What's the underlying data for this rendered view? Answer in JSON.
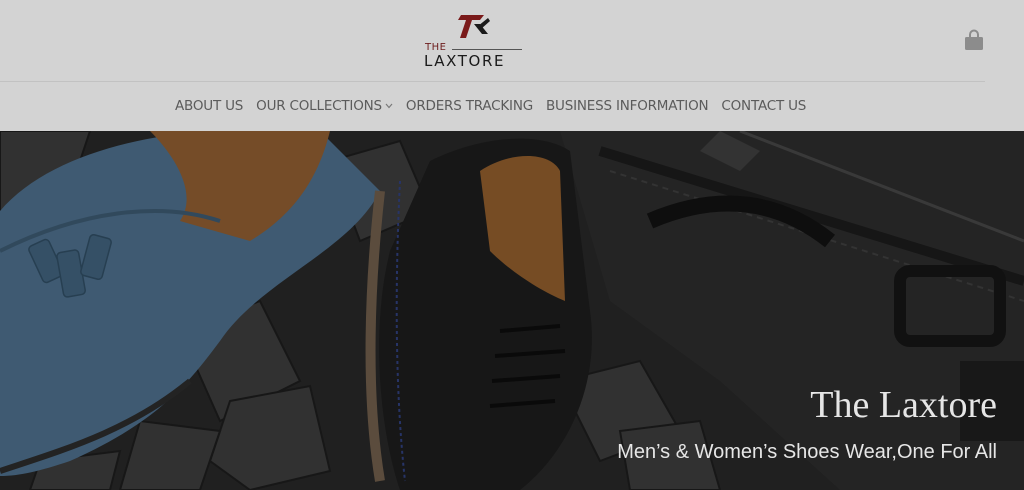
{
  "brand": {
    "logo_prefix": "THE",
    "logo_name": "LAXTORE",
    "colors": {
      "mark_red": "#7a1a1a",
      "mark_dark": "#1a1a1a"
    }
  },
  "header": {
    "cart_icon": "shopping-bag-icon"
  },
  "nav": {
    "items": [
      {
        "label": "ABOUT US",
        "has_dropdown": false
      },
      {
        "label": "OUR COLLECTIONS",
        "has_dropdown": true
      },
      {
        "label": "ORDERS TRACKING",
        "has_dropdown": false
      },
      {
        "label": "BUSINESS INFORMATION",
        "has_dropdown": false
      },
      {
        "label": "CONTACT US",
        "has_dropdown": false
      }
    ]
  },
  "hero": {
    "title": "The Laxtore",
    "subtitle": "Men’s & Women’s Shoes Wear,One For All",
    "overlay": "#000000"
  }
}
